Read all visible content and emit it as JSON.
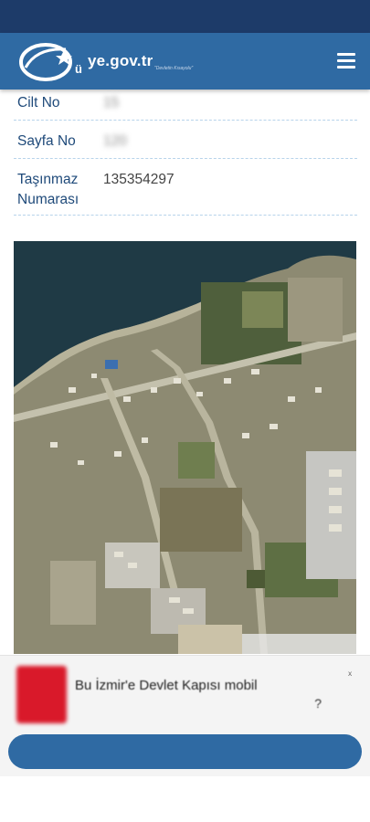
{
  "header": {
    "logo_text": "ye.gov.tr",
    "logo_tagline": "\"Devletin Kısayolu\"",
    "colors": {
      "status_bar": "#1d3b69",
      "header": "#2f6aa3"
    }
  },
  "rows": [
    {
      "label": "Cilt No",
      "value": "15"
    },
    {
      "label": "Sayfa No",
      "value": "120"
    },
    {
      "label": "Taşınmaz Numarası",
      "value": "135354297"
    }
  ],
  "map": {
    "kind": "satellite-image",
    "colors": {
      "sea": "#1f3a45",
      "land": "#8d8a72",
      "fields": "#6e7e55"
    }
  },
  "banner": {
    "title": "Bu İzmir'e Devlet Kapısı mobil",
    "subtitle": "?",
    "close": "ˣ",
    "button_label": "",
    "icon": "app-icon"
  }
}
